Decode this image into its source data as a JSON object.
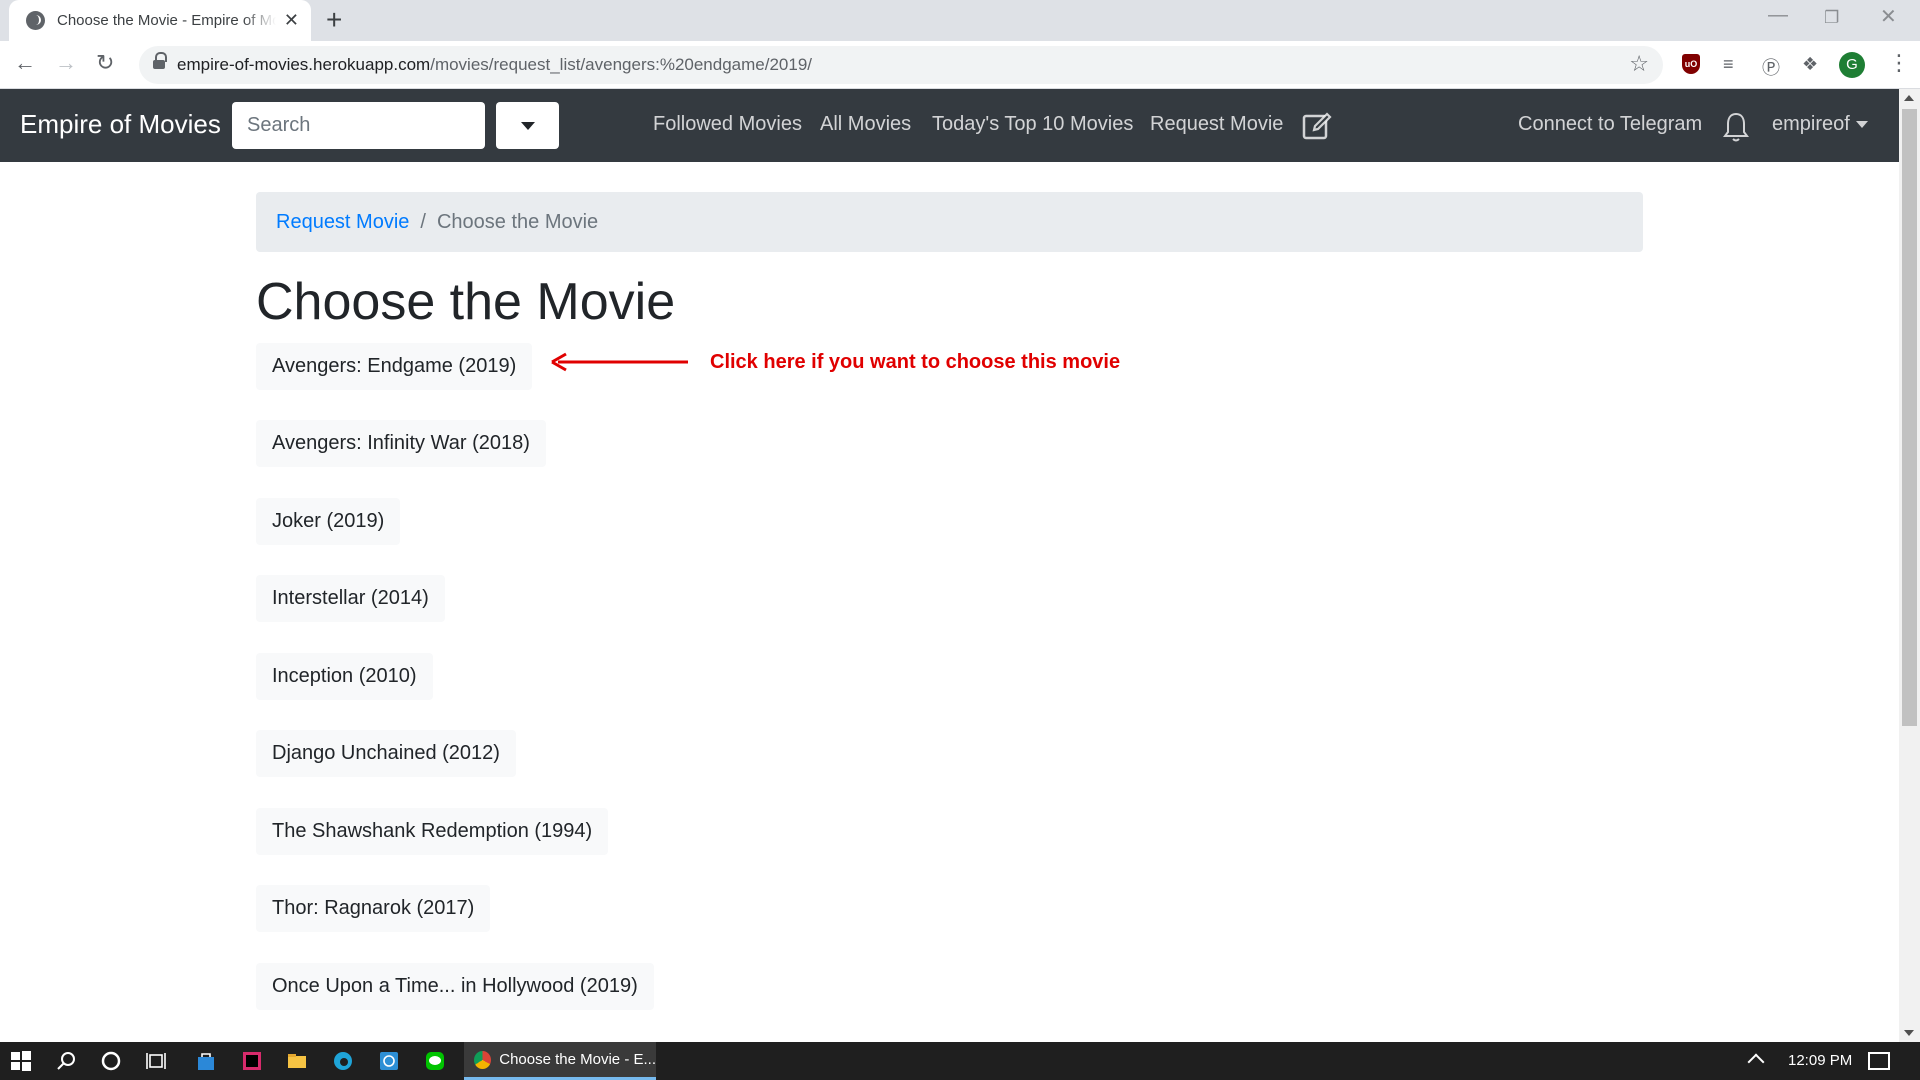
{
  "browser": {
    "tab_title": "Choose the Movie - Empire of Movies",
    "new_tab": "+",
    "tab_close": "✕",
    "url_host": "empire-of-movies.herokuapp.com",
    "url_path": "/movies/request_list/avengers:%20endgame/2019/",
    "profile_initial": "G",
    "ublock_label": "uO"
  },
  "navbar": {
    "brand": "Empire of Movies",
    "search_placeholder": "Search",
    "links": [
      "Followed Movies",
      "All Movies",
      "Today's Top 10 Movies",
      "Request Movie"
    ],
    "telegram": "Connect to Telegram",
    "user": "empireof"
  },
  "breadcrumb": {
    "parent": "Request Movie",
    "separator": "/",
    "current": "Choose the Movie"
  },
  "page_title": "Choose the Movie",
  "movies": [
    "Avengers: Endgame (2019)",
    "Avengers: Infinity War (2018)",
    "Joker (2019)",
    "Interstellar (2014)",
    "Inception (2010)",
    "Django Unchained (2012)",
    "The Shawshank Redemption (1994)",
    "Thor: Ragnarok (2017)",
    "Once Upon a Time... in Hollywood (2019)"
  ],
  "annotation": {
    "text": "Click here if you want to choose this movie",
    "color": "#e00000"
  },
  "taskbar": {
    "active_app": "Choose the Movie - E...",
    "clock": "12:09 PM"
  },
  "colors": {
    "navbar_bg": "#343a40",
    "link": "#007bff",
    "breadcrumb_bg": "#e9ecef",
    "button_bg": "#f8f9fa"
  }
}
